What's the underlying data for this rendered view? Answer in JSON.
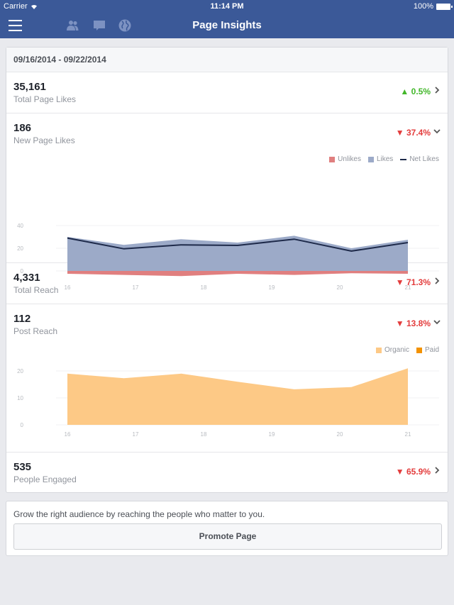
{
  "status_bar": {
    "carrier": "Carrier",
    "time": "11:14 PM",
    "battery": "100%"
  },
  "nav": {
    "title": "Page Insights",
    "icons": [
      "menu-icon",
      "friends-icon",
      "messages-icon",
      "globe-icon"
    ]
  },
  "date_range": "09/16/2014 - 09/22/2014",
  "metrics": [
    {
      "value": "35,161",
      "label": "Total Page Likes",
      "delta": "0.5%",
      "direction": "up",
      "expanded": false
    },
    {
      "value": "186",
      "label": "New Page Likes",
      "delta": "37.4%",
      "direction": "down",
      "expanded": true
    },
    {
      "value": "4,331",
      "label": "Total Reach",
      "delta": "71.3%",
      "direction": "down",
      "expanded": false
    },
    {
      "value": "112",
      "label": "Post Reach",
      "delta": "13.8%",
      "direction": "down",
      "expanded": true
    },
    {
      "value": "535",
      "label": "People Engaged",
      "delta": "65.9%",
      "direction": "down",
      "expanded": false
    }
  ],
  "colors": {
    "brand": "#3b5998",
    "up": "#42b72a",
    "down": "#e33c3c",
    "unlikes": "#e07f7f",
    "likes": "#9caac8",
    "net_likes": "#1e2a4a",
    "organic": "#fdc986",
    "paid": "#f39200"
  },
  "chart_data": [
    {
      "type": "area",
      "title": "New Page Likes",
      "x": [
        16,
        16.83,
        17.67,
        18.5,
        19.33,
        20.17,
        21
      ],
      "xticks": [
        "16",
        "17",
        "18",
        "19",
        "20",
        "21"
      ],
      "yticks": [
        "40",
        "20",
        "0"
      ],
      "ylim": [
        -5,
        40
      ],
      "legend_position": "top-right",
      "grid": true,
      "series": [
        {
          "name": "Unlikes",
          "kind": "area",
          "values": [
            -2.5,
            -3.5,
            -4.5,
            -2.5,
            -3.5,
            -2,
            -2.5
          ]
        },
        {
          "name": "Likes",
          "kind": "area",
          "values": [
            30,
            23,
            28,
            25,
            31,
            20,
            27.5
          ]
        },
        {
          "name": "Net Likes",
          "kind": "line",
          "values": [
            29,
            19.5,
            23,
            22.5,
            28,
            17.5,
            25
          ]
        }
      ]
    },
    {
      "type": "area",
      "title": "Post Reach",
      "x": [
        16,
        16.83,
        17.67,
        18.5,
        19.33,
        20.17,
        21
      ],
      "xticks": [
        "16",
        "17",
        "18",
        "19",
        "20",
        "21"
      ],
      "yticks": [
        "20",
        "10",
        "0"
      ],
      "ylim": [
        0,
        20
      ],
      "legend_position": "top-right",
      "grid": true,
      "series": [
        {
          "name": "Organic",
          "kind": "area",
          "values": [
            19,
            17.3,
            19,
            16,
            13.2,
            14,
            21
          ]
        },
        {
          "name": "Paid",
          "kind": "area",
          "values": [
            0,
            0,
            0,
            0,
            0,
            0,
            0
          ]
        }
      ]
    }
  ],
  "promo": {
    "text": "Grow the right audience by reaching the people who matter to you.",
    "button_label": "Promote Page"
  }
}
